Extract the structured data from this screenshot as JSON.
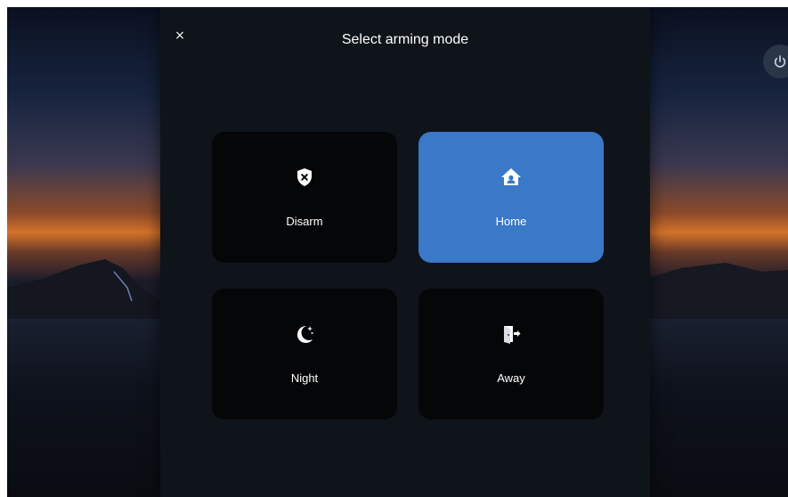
{
  "dialog": {
    "title": "Select arming mode",
    "close_label": "×"
  },
  "modes": [
    {
      "id": "disarm",
      "label": "Disarm",
      "icon": "shield-off-icon",
      "selected": false
    },
    {
      "id": "home",
      "label": "Home",
      "icon": "home-shield-icon",
      "selected": true
    },
    {
      "id": "night",
      "label": "Night",
      "icon": "moon-icon",
      "selected": false
    },
    {
      "id": "away",
      "label": "Away",
      "icon": "exit-door-icon",
      "selected": false
    }
  ],
  "colors": {
    "selected": "#3a78c8",
    "card": "#050608",
    "dialog": "#0f131a"
  }
}
